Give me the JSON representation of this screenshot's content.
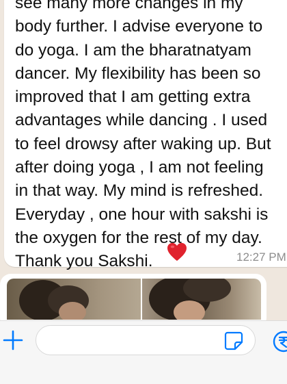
{
  "message": {
    "lines": [
      "see many more changes in my",
      "body further. I advise everyone to",
      "do yoga. I am the bharatnatyam",
      "dancer. My flexibility has been so",
      "improved that I am getting extra",
      "advantages while dancing . I used",
      "to feel drowsy after waking up. But",
      "after doing yoga , I am not feeling",
      "in that way. My mind is refreshed.",
      "Everyday , one hour with sakshi is",
      "the oxygen for the rest of my day.",
      "Thank you Sakshi."
    ],
    "emoji_icon": "red-heart-icon",
    "time": "12:27 PM"
  },
  "media": {
    "thumbnails": [
      "photo-1",
      "photo-2"
    ]
  },
  "composer": {
    "placeholder": "",
    "value": "",
    "icons": [
      "plus-icon",
      "sticker-icon",
      "rupee-payment-icon"
    ]
  },
  "colors": {
    "chat_background": "#efe7de",
    "bubble": "#ffffff",
    "accent": "#007aff",
    "heart": "#e0232e",
    "timestamp": "#8c8c8c"
  }
}
